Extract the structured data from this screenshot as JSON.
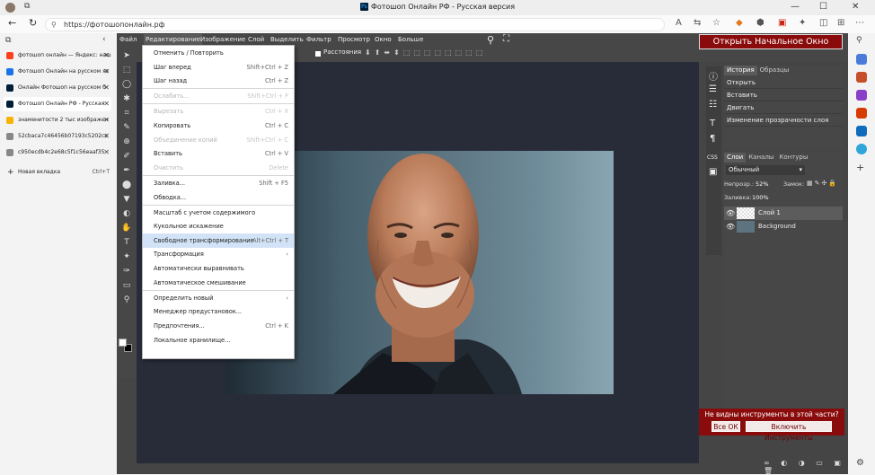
{
  "browser": {
    "window_title": "Фотошоп Онлайн РФ - Русская версия",
    "url": "https://фотошопонлайн.рф",
    "new_tab": {
      "label": "Новая вкладка",
      "shortcut": "Ctrl+T"
    },
    "tabs": [
      {
        "title": "фотошоп онлайн — Яндекс: наш",
        "color": "#fc3f1d"
      },
      {
        "title": "Фотошоп Онлайн на русском яз",
        "color": "#1a73e8"
      },
      {
        "title": "Онлайн Фотошоп на русском б",
        "color": "#001e36"
      },
      {
        "title": "Фотошоп Онлайн РФ - Русская",
        "color": "#001e36"
      },
      {
        "title": "знаменитости 2 тыс изображен",
        "color": "#f6b400"
      },
      {
        "title": "52cbaca7c46456b07193c5202cc",
        "color": "#888888"
      },
      {
        "title": "c950ecdb4c2e68c5f1c56eaaf35",
        "color": "#888888"
      }
    ]
  },
  "menu": {
    "items": [
      "Файл",
      "Редактирование",
      "Изображение",
      "Слой",
      "Выделить",
      "Фильтр",
      "Просмотр",
      "Окно",
      "Больше"
    ],
    "open_start": "Открыть Начальное Окно",
    "distances_label": "Расстояния"
  },
  "dropdown": [
    {
      "label": "Отменить / Повторить",
      "shortcut": "",
      "disabled": false
    },
    {
      "label": "Шаг вперед",
      "shortcut": "Shift+Ctrl + Z",
      "disabled": false
    },
    {
      "label": "Шаг назад",
      "shortcut": "Ctrl + Z",
      "disabled": false
    },
    {
      "label": "Ослабить...",
      "shortcut": "Shift+Ctrl + F",
      "disabled": true
    },
    {
      "label": "Вырезать",
      "shortcut": "Ctrl + X",
      "disabled": true
    },
    {
      "label": "Копировать",
      "shortcut": "Ctrl + C",
      "disabled": false
    },
    {
      "label": "Объединение копий",
      "shortcut": "Shift+Ctrl + C",
      "disabled": true
    },
    {
      "label": "Вставить",
      "shortcut": "Ctrl + V",
      "disabled": false
    },
    {
      "label": "Очистить",
      "shortcut": "Delete",
      "disabled": true
    },
    {
      "label": "Заливка...",
      "shortcut": "Shift + F5",
      "disabled": false
    },
    {
      "label": "Обводка...",
      "shortcut": "",
      "disabled": false
    },
    {
      "label": "Масштаб с учетом содержимого",
      "shortcut": "",
      "disabled": false
    },
    {
      "label": "Кукольное искажение",
      "shortcut": "",
      "disabled": false
    },
    {
      "label": "Свободное трансформирование",
      "shortcut": "Alt+Ctrl + T",
      "disabled": false,
      "highlighted": true
    },
    {
      "label": "Трансформация",
      "shortcut": "›",
      "disabled": false
    },
    {
      "label": "Автоматически выравнивать",
      "shortcut": "",
      "disabled": false
    },
    {
      "label": "Автоматическое смешивание",
      "shortcut": "",
      "disabled": false
    },
    {
      "label": "Определить новый",
      "shortcut": "›",
      "disabled": false
    },
    {
      "label": "Менеджер предустановок...",
      "shortcut": "",
      "disabled": false
    },
    {
      "label": "Предпочтения...",
      "shortcut": "Ctrl + K",
      "disabled": false
    },
    {
      "label": "Локальное хранилище...",
      "shortcut": "",
      "disabled": false
    }
  ],
  "history_panel": {
    "tabs": [
      "История",
      "Образцы"
    ],
    "items": [
      "Открыть",
      "Вставить",
      "Двигать",
      "Изменение прозрачности слоя"
    ]
  },
  "layers_panel": {
    "tabs": [
      "Слои",
      "Каналы",
      "Контуры"
    ],
    "blend_mode": "Обычный",
    "opacity_label": "Непрозр.:",
    "opacity": "52%",
    "lock_label": "Замок:",
    "fill_label": "Заливка:",
    "fill": "100%",
    "layers": [
      "Слой 1",
      "Background"
    ]
  },
  "notice": {
    "text": "Не видны инструменты в этой части?",
    "ok": "Все ОК",
    "enable": "Включить Инструменты"
  },
  "colors": {
    "brand_red": "#8a0b0b",
    "highlight": "#d3e3f7"
  }
}
